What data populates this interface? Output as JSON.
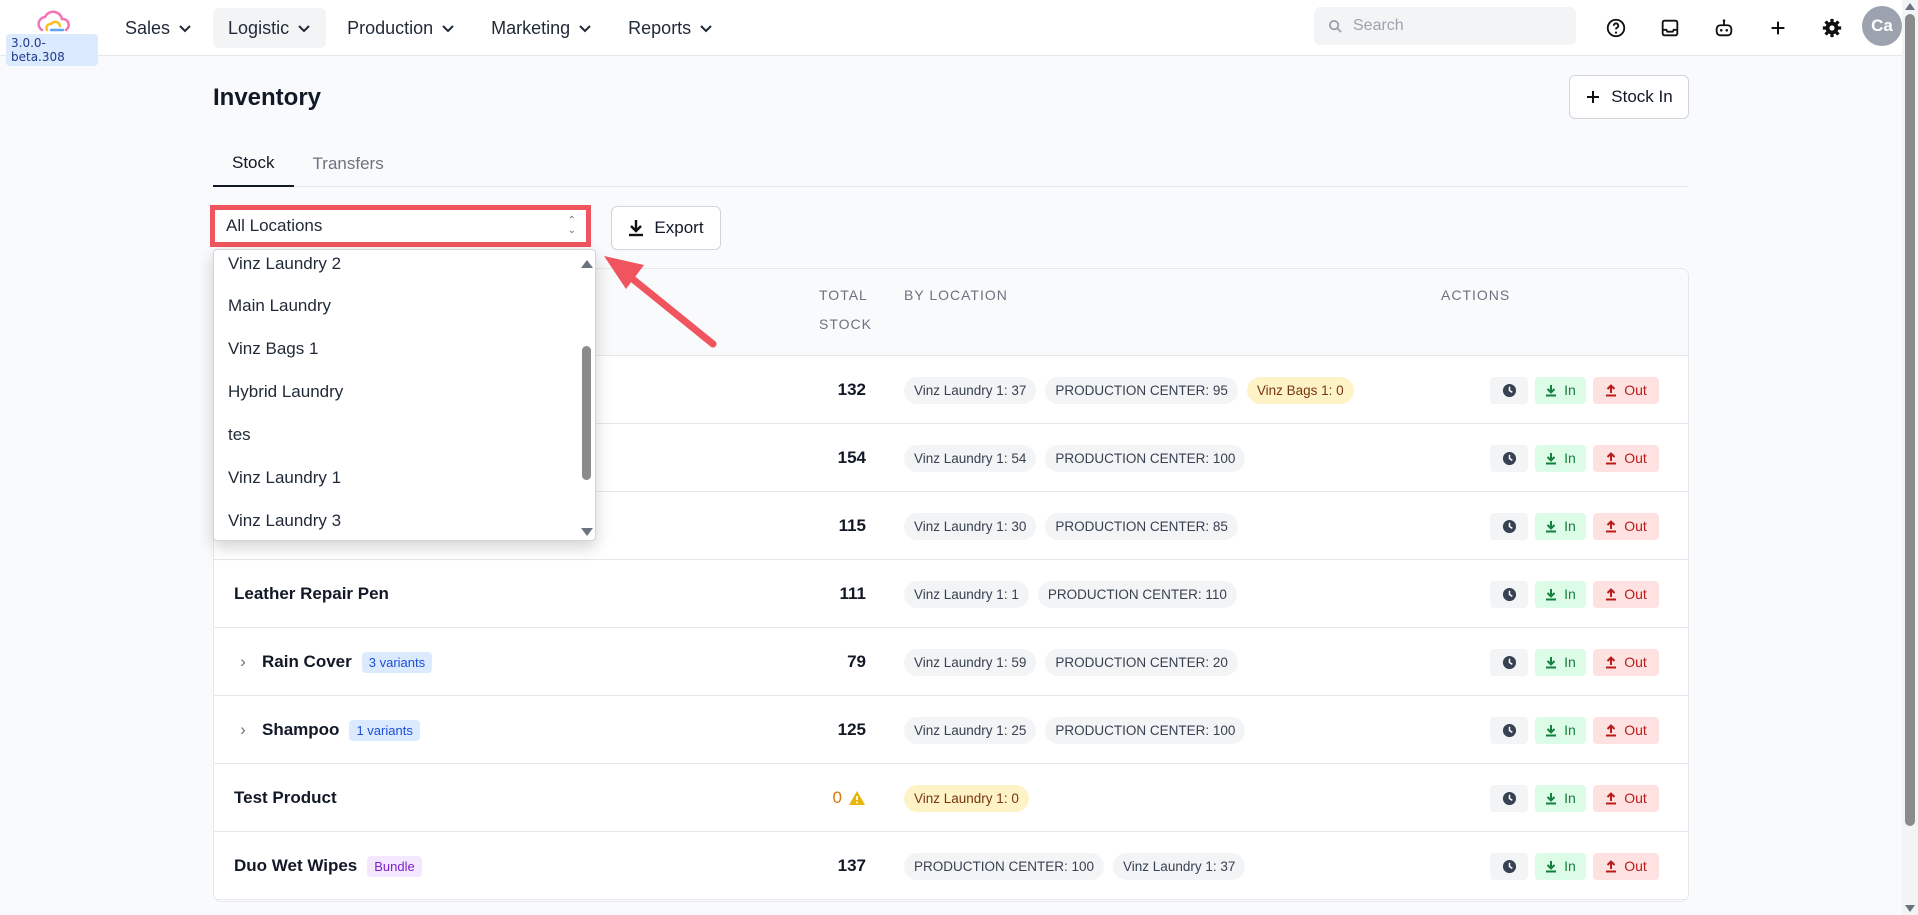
{
  "app": {
    "version": "3.0.0-beta.308",
    "nav": [
      {
        "label": "Sales"
      },
      {
        "label": "Logistic"
      },
      {
        "label": "Production"
      },
      {
        "label": "Marketing"
      },
      {
        "label": "Reports"
      }
    ],
    "search_placeholder": "Search",
    "avatar_initials": "Ca"
  },
  "page": {
    "title": "Inventory",
    "stock_in_label": "Stock In",
    "tabs": [
      {
        "label": "Stock"
      },
      {
        "label": "Transfers"
      }
    ],
    "location_filter": "All Locations",
    "export_label": "Export"
  },
  "dropdown": {
    "options": [
      "Vinz Laundry 2",
      "Main Laundry",
      "Vinz Bags 1",
      "Hybrid Laundry",
      "tes",
      "Vinz Laundry 1",
      "Vinz Laundry 3"
    ]
  },
  "table": {
    "headers": {
      "total_1": "TOTAL",
      "total_2": "STOCK",
      "by_location": "BY LOCATION",
      "actions": "ACTIONS"
    },
    "action_labels": {
      "in": "In",
      "out": "Out"
    },
    "rows": [
      {
        "name": "",
        "total": "132",
        "locations": [
          "Vinz Laundry 1: 37",
          "PRODUCTION CENTER: 95",
          "Vinz Bags 1: 0"
        ]
      },
      {
        "name": "",
        "total": "154",
        "locations": [
          "Vinz Laundry 1: 54",
          "PRODUCTION CENTER: 100"
        ]
      },
      {
        "name": "",
        "total": "115",
        "locations": [
          "Vinz Laundry 1: 30",
          "PRODUCTION CENTER: 85"
        ]
      },
      {
        "name": "Leather Repair Pen",
        "total": "111",
        "locations": [
          "Vinz Laundry 1: 1",
          "PRODUCTION CENTER: 110"
        ]
      },
      {
        "name": "Rain Cover",
        "badge": "3 variants",
        "total": "79",
        "locations": [
          "Vinz Laundry 1: 59",
          "PRODUCTION CENTER: 20"
        ]
      },
      {
        "name": "Shampoo",
        "badge": "1 variants",
        "total": "125",
        "locations": [
          "Vinz Laundry 1: 25",
          "PRODUCTION CENTER: 100"
        ]
      },
      {
        "name": "Test Product",
        "total": "0",
        "locations": [
          "Vinz Laundry 1: 0"
        ]
      },
      {
        "name": "Duo Wet Wipes",
        "badge": "Bundle",
        "total": "137",
        "locations": [
          "PRODUCTION CENTER: 100",
          "Vinz Laundry 1: 37"
        ]
      }
    ]
  },
  "colors": {
    "highlight": "#f0555f",
    "in_green": "#15803d",
    "out_red": "#b91c1c",
    "warning": "#d97706"
  }
}
